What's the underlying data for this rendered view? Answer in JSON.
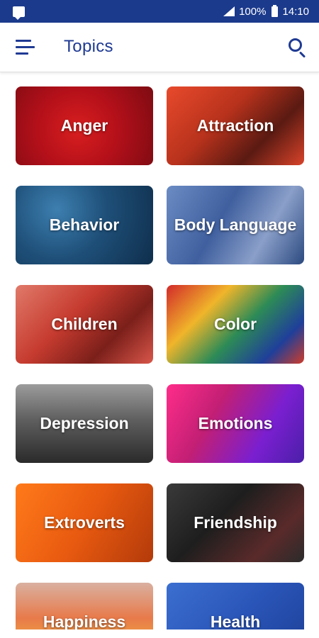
{
  "status_bar": {
    "battery": "100%",
    "time": "14:10",
    "icons": [
      "message-icon",
      "signal-icon",
      "battery-icon"
    ]
  },
  "app_bar": {
    "title": "Topics",
    "menu_icon": "menu-icon",
    "search_icon": "search-icon"
  },
  "colors": {
    "status_bar": "#1b3a8c",
    "accent": "#1f3a93"
  },
  "topics": [
    {
      "label": "Anger",
      "style": "anger"
    },
    {
      "label": "Attraction",
      "style": "attraction"
    },
    {
      "label": "Behavior",
      "style": "behavior"
    },
    {
      "label": "Body Language",
      "style": "body"
    },
    {
      "label": "Children",
      "style": "children"
    },
    {
      "label": "Color",
      "style": "color"
    },
    {
      "label": "Depression",
      "style": "depression"
    },
    {
      "label": "Emotions",
      "style": "emotions"
    },
    {
      "label": "Extroverts",
      "style": "extroverts"
    },
    {
      "label": "Friendship",
      "style": "friendship"
    },
    {
      "label": "Happiness",
      "style": "happiness"
    },
    {
      "label": "Health",
      "style": "health"
    }
  ]
}
